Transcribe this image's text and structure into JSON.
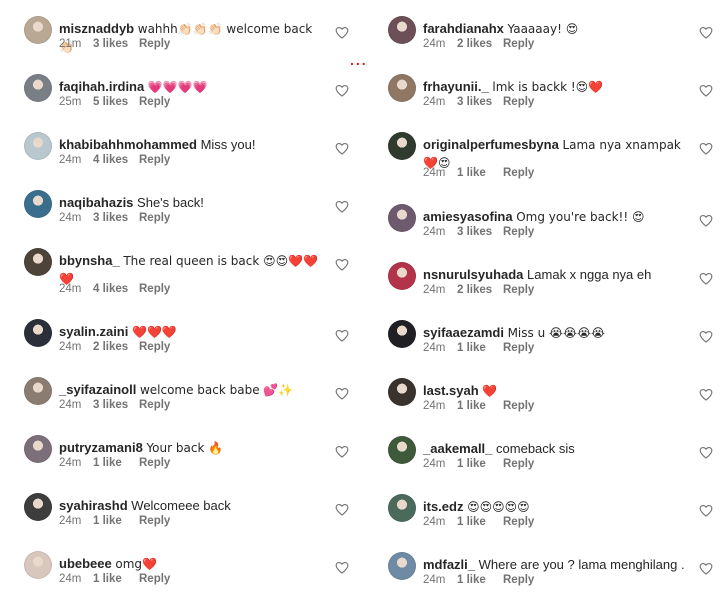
{
  "left": [
    {
      "user": "misznaddyb",
      "text": "wahhh👏🏻👏🏻👏🏻 welcome back👏🏻",
      "time": "21m",
      "likes": "3 likes",
      "reply": "Reply",
      "avatar_color": "#b8a894"
    },
    {
      "user": "faqihah.irdina",
      "text": "💗💗💗💗",
      "time": "25m",
      "likes": "5 likes",
      "reply": "Reply",
      "avatar_color": "#7a7f86"
    },
    {
      "user": "khabibahhmohammed",
      "text": "Miss you!",
      "time": "24m",
      "likes": "4 likes",
      "reply": "Reply",
      "avatar_color": "#b9c7cf"
    },
    {
      "user": "naqibahazis",
      "text": "She's back!",
      "time": "24m",
      "likes": "3 likes",
      "reply": "Reply",
      "avatar_color": "#3b6e8d"
    },
    {
      "user": "bbynsha_",
      "text": "The real queen is back 😍😍❤️❤️❤️",
      "time": "24m",
      "likes": "4 likes",
      "reply": "Reply",
      "avatar_color": "#4e4339"
    },
    {
      "user": "syalin.zaini",
      "text": "❤️❤️❤️",
      "time": "24m",
      "likes": "2 likes",
      "reply": "Reply",
      "avatar_color": "#2a2f3a"
    },
    {
      "user": "_syifazainoll",
      "text": "welcome back babe 💕✨",
      "time": "24m",
      "likes": "3 likes",
      "reply": "Reply",
      "avatar_color": "#8b7c72"
    },
    {
      "user": "putryzamani8",
      "text": "Your back 🔥",
      "time": "24m",
      "likes": "1 like",
      "reply": "Reply",
      "avatar_color": "#7d6f79"
    },
    {
      "user": "syahirashd",
      "text": "Welcomeee back",
      "time": "24m",
      "likes": "1 like",
      "reply": "Reply",
      "avatar_color": "#3d3d3d"
    },
    {
      "user": "ubebeee",
      "text": "omg❤️",
      "time": "24m",
      "likes": "1 like",
      "reply": "Reply",
      "avatar_color": "#d8c7bd"
    }
  ],
  "right": [
    {
      "user": "farahdianahx",
      "text": "Yaaaaay! 😍",
      "time": "24m",
      "likes": "2 likes",
      "reply": "Reply",
      "avatar_color": "#6d4f57"
    },
    {
      "user": "frhayunii._",
      "text": "lmk is backk !😍❤️",
      "time": "24m",
      "likes": "3 likes",
      "reply": "Reply",
      "avatar_color": "#8f7764"
    },
    {
      "user": "originalperfumesbyna",
      "text": "Lama nya xnampak❤️😍",
      "time": "24m",
      "likes": "1 like",
      "reply": "Reply",
      "avatar_color": "#2f3b2e"
    },
    {
      "user": "amiesyasofina",
      "text": "Omg you're back!! 😍",
      "time": "24m",
      "likes": "3 likes",
      "reply": "Reply",
      "avatar_color": "#6e5a6e"
    },
    {
      "user": "nsnurulsyuhada",
      "text": "Lamak x ngga nya eh",
      "time": "24m",
      "likes": "2 likes",
      "reply": "Reply",
      "avatar_color": "#b3334a"
    },
    {
      "user": "syifaaezamdi",
      "text": "Miss u 😭😭😭😭",
      "time": "24m",
      "likes": "1 like",
      "reply": "Reply",
      "avatar_color": "#1f1f24"
    },
    {
      "user": "last.syah",
      "text": "❤️",
      "time": "24m",
      "likes": "1 like",
      "reply": "Reply",
      "avatar_color": "#3a332d"
    },
    {
      "user": "_aakemall_",
      "text": "comeback sis",
      "time": "24m",
      "likes": "1 like",
      "reply": "Reply",
      "avatar_color": "#3f5a3a"
    },
    {
      "user": "its.edz",
      "text": "😍😍😍😍😍",
      "time": "24m",
      "likes": "1 like",
      "reply": "Reply",
      "avatar_color": "#4b6a5c"
    },
    {
      "user": "mdfazli_",
      "text": "Where are you ? lama menghilang .",
      "time": "24m",
      "likes": "1 like",
      "reply": "Reply",
      "avatar_color": "#6f8aa4"
    }
  ],
  "divider": "..."
}
